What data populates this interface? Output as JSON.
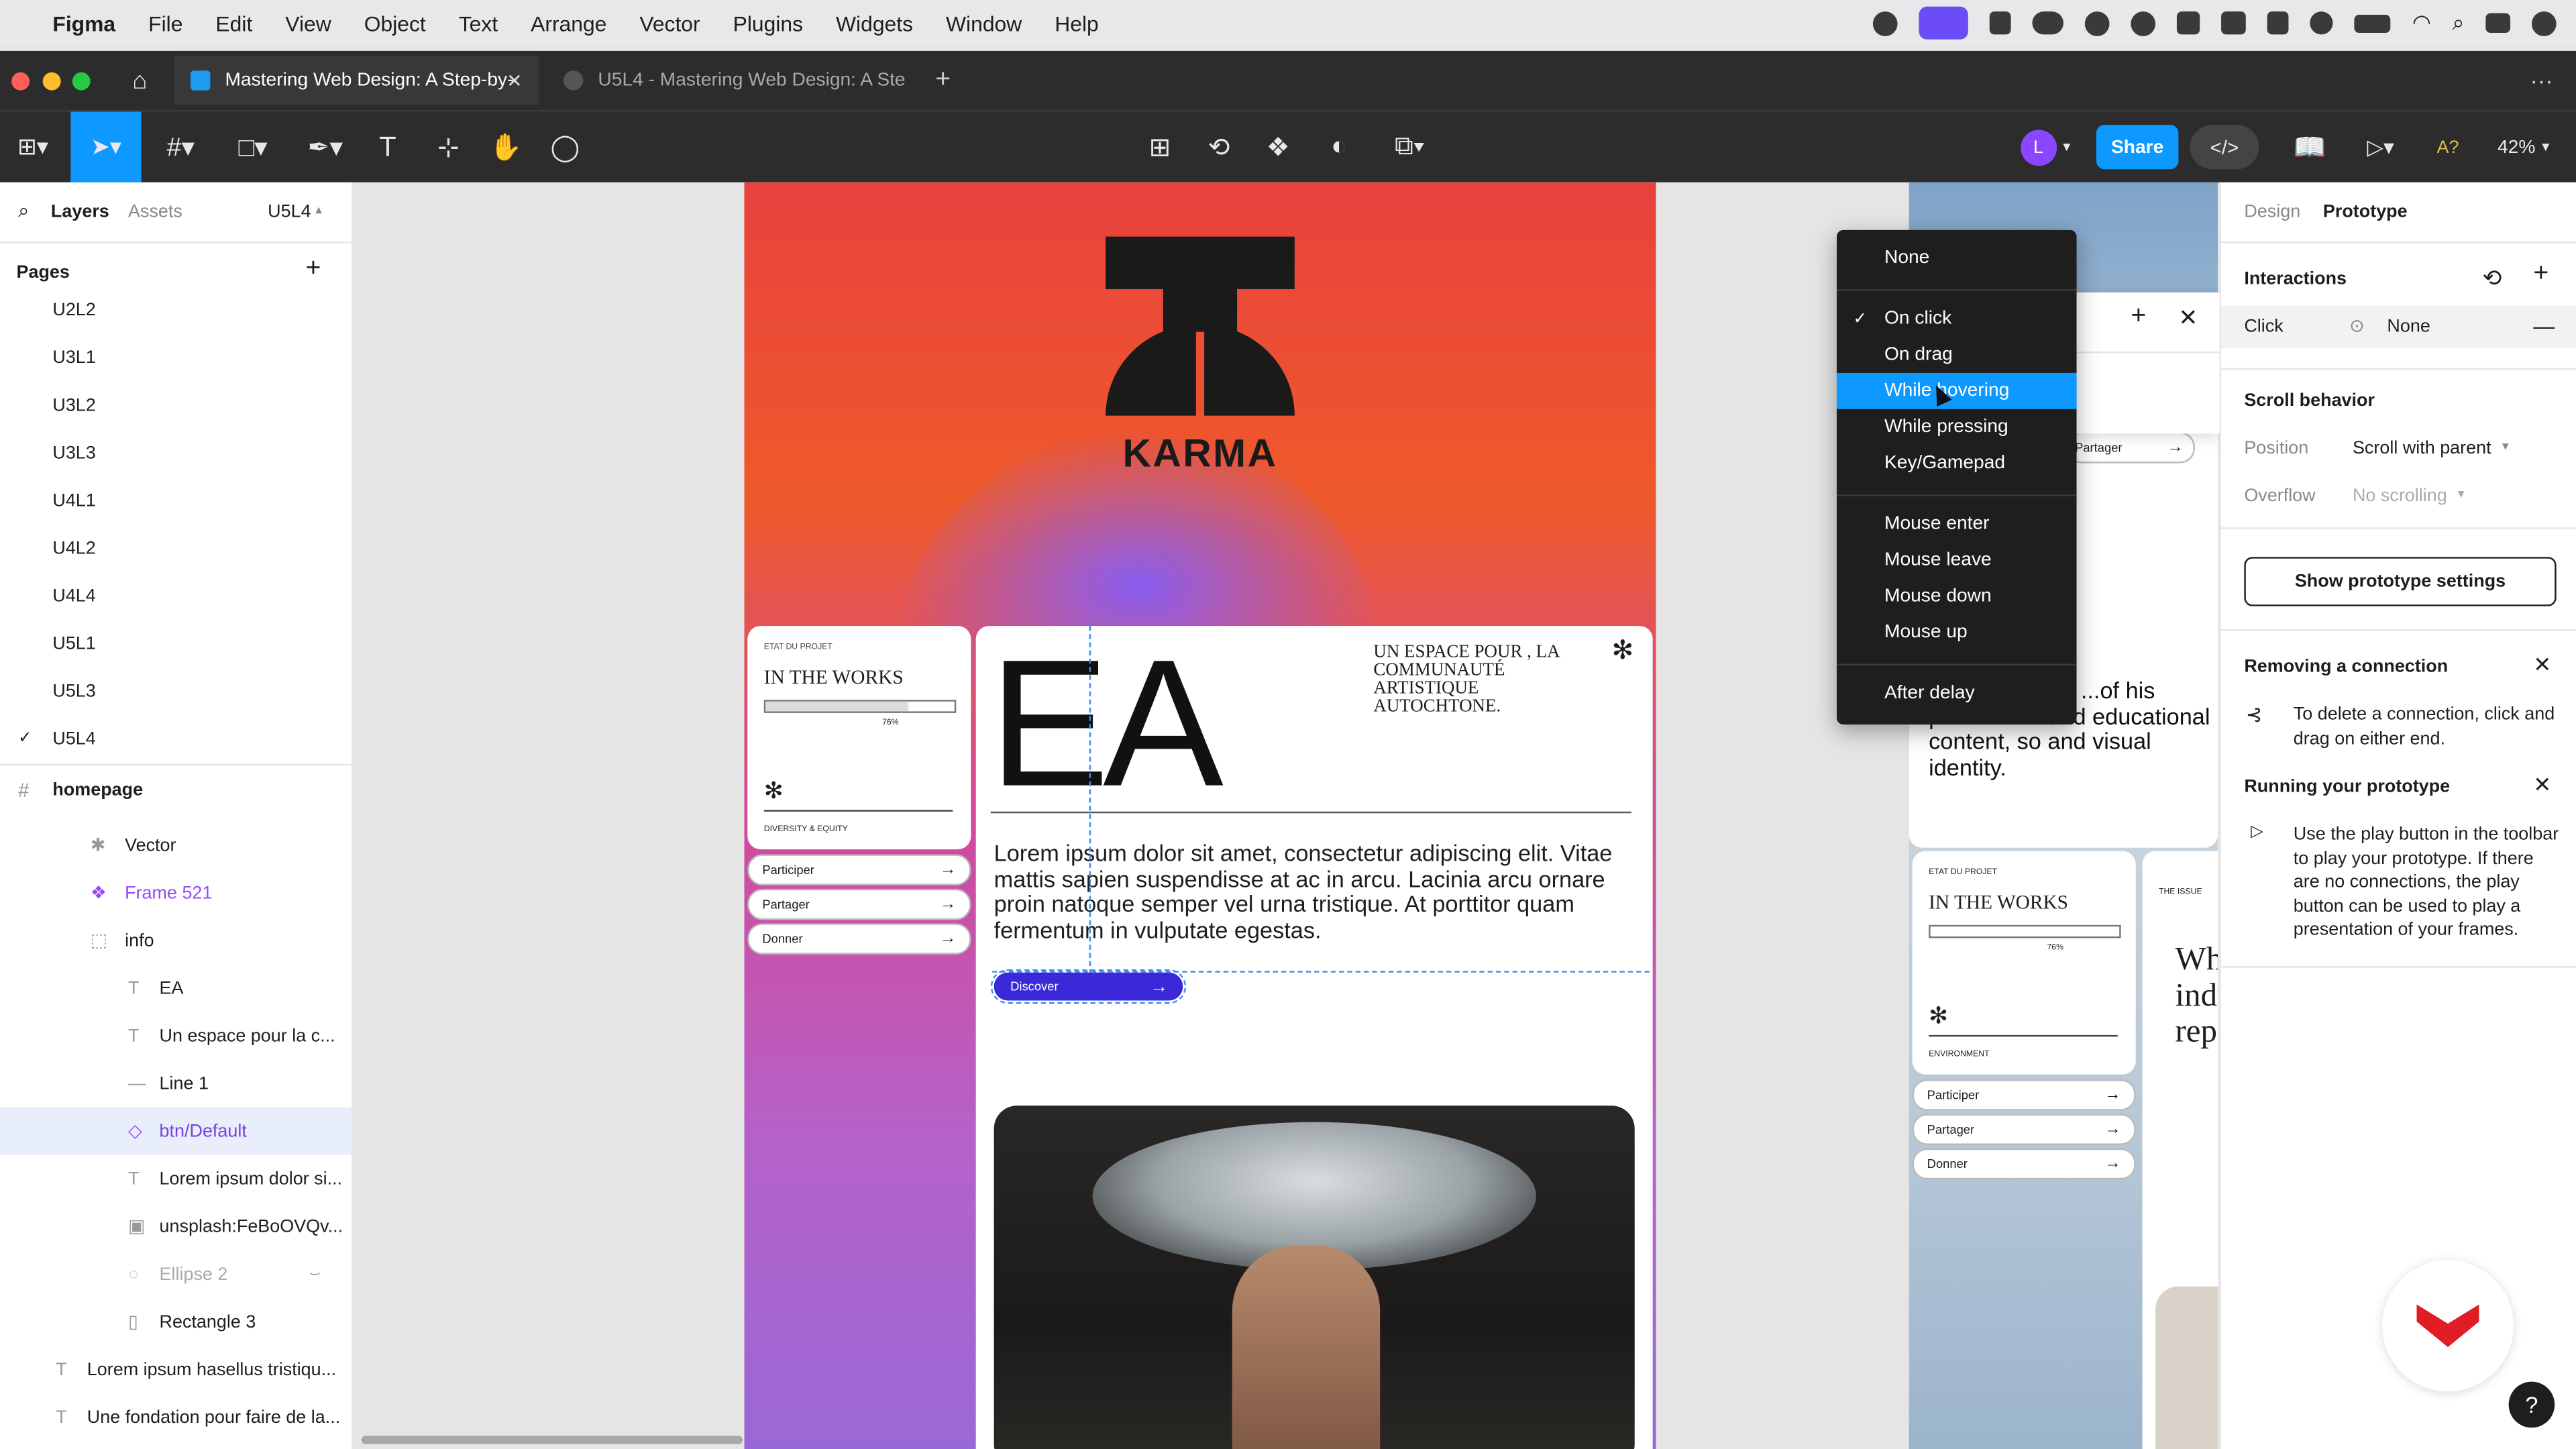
{
  "menubar": {
    "app": "Figma",
    "items": [
      "File",
      "Edit",
      "View",
      "Object",
      "Text",
      "Arrange",
      "Vector",
      "Plugins",
      "Widgets",
      "Window",
      "Help"
    ]
  },
  "tabs": [
    {
      "label": "Mastering Web Design: A Step-by-",
      "active": true
    },
    {
      "label": "U5L4 - Mastering Web Design: A Ste",
      "active": false
    }
  ],
  "toolbar": {
    "share": "Share",
    "zoom": "42%",
    "avatar": "L",
    "font_hint": "A?"
  },
  "left_panel": {
    "tabs": {
      "layers": "Layers",
      "assets": "Assets",
      "page": "U5L4"
    },
    "pages_title": "Pages",
    "pages": [
      "U2L2",
      "U3L1",
      "U3L2",
      "U3L3",
      "U4L1",
      "U4L2",
      "U4L4",
      "U5L1",
      "U5L3",
      "U5L4"
    ],
    "frame": "homepage",
    "layers": [
      {
        "label": "Vector",
        "icon": "vector-icon"
      },
      {
        "label": "Frame 521",
        "icon": "component-icon"
      },
      {
        "label": "info",
        "icon": "frame-dotted-icon"
      },
      {
        "label": "EA",
        "icon": "text-icon"
      },
      {
        "label": "Un espace pour  la c...",
        "icon": "text-icon"
      },
      {
        "label": "Line 1",
        "icon": "line-icon"
      },
      {
        "label": "btn/Default",
        "icon": "instance-icon"
      },
      {
        "label": "Lorem ipsum dolor si...",
        "icon": "text-icon"
      },
      {
        "label": "unsplash:FeBoOVQv...",
        "icon": "image-icon"
      },
      {
        "label": "Ellipse 2",
        "icon": "ellipse-icon"
      },
      {
        "label": "Rectangle 3",
        "icon": "rectangle-icon"
      },
      {
        "label": "Lorem ipsum hasellus tristiqu...",
        "icon": "text-icon"
      },
      {
        "label": "Une fondation pour faire de la...",
        "icon": "text-icon"
      }
    ]
  },
  "design": {
    "brand": "KARMA",
    "status_small": "ETAT DU PROJET",
    "status_title": "IN THE WORKS",
    "progress_label": "76%",
    "progress": 0.76,
    "category": "DIVERSITY & EQUITY",
    "actions": [
      "Participer",
      "Partager",
      "Donner"
    ],
    "hero_title": "EA",
    "tagline": "UN ESPACE POUR , LA COMMUNAUTÉ ARTISTIQUE AUTOCHTONE.",
    "body": "Lorem ipsum dolor sit amet, consectetur adipiscing elit. Vitae mattis sapien suspendisse at ac in arcu. Lacinia arcu ornare proin natoque semper vel urna tristique. At porttitor quam fermentum in vulputate egestas.",
    "cta": "Discover"
  },
  "design2": {
    "status_small": "ETAT DU PROJET",
    "status_title": "IN THE WORKS",
    "progress_label": "76%",
    "category": "ENVIRONMENT",
    "actions": [
      "Participer",
      "Partager",
      "Donner"
    ],
    "partial_text": "on with O. Bor ...of his plastics wo and educational content, so and visual identity.",
    "partial_share": "Partager",
    "issue_small": "THE ISSUE",
    "issue_text": "Wh indu rep"
  },
  "trigger_menu": {
    "items": [
      "None",
      "On click",
      "On drag",
      "While hovering",
      "While pressing",
      "Key/Gamepad",
      "Mouse enter",
      "Mouse leave",
      "Mouse down",
      "Mouse up",
      "After delay"
    ],
    "checked": "On click",
    "hovered": "While hovering"
  },
  "right_panel": {
    "tabs": {
      "design": "Design",
      "prototype": "Prototype"
    },
    "interactions_title": "Interactions",
    "interaction": {
      "trigger": "Click",
      "action": "None"
    },
    "scroll_title": "Scroll behavior",
    "position_label": "Position",
    "position_value": "Scroll with parent",
    "overflow_label": "Overflow",
    "overflow_value": "No scrolling",
    "settings_button": "Show prototype settings",
    "tip1_title": "Removing a connection",
    "tip1_text": "To delete a connection, click and drag on either end.",
    "tip2_title": "Running your prototype",
    "tip2_text": "Use the play button in the toolbar to play your prototype. If there are no connections, the play button can be used to play a presentation of your frames.",
    "help": "?"
  }
}
